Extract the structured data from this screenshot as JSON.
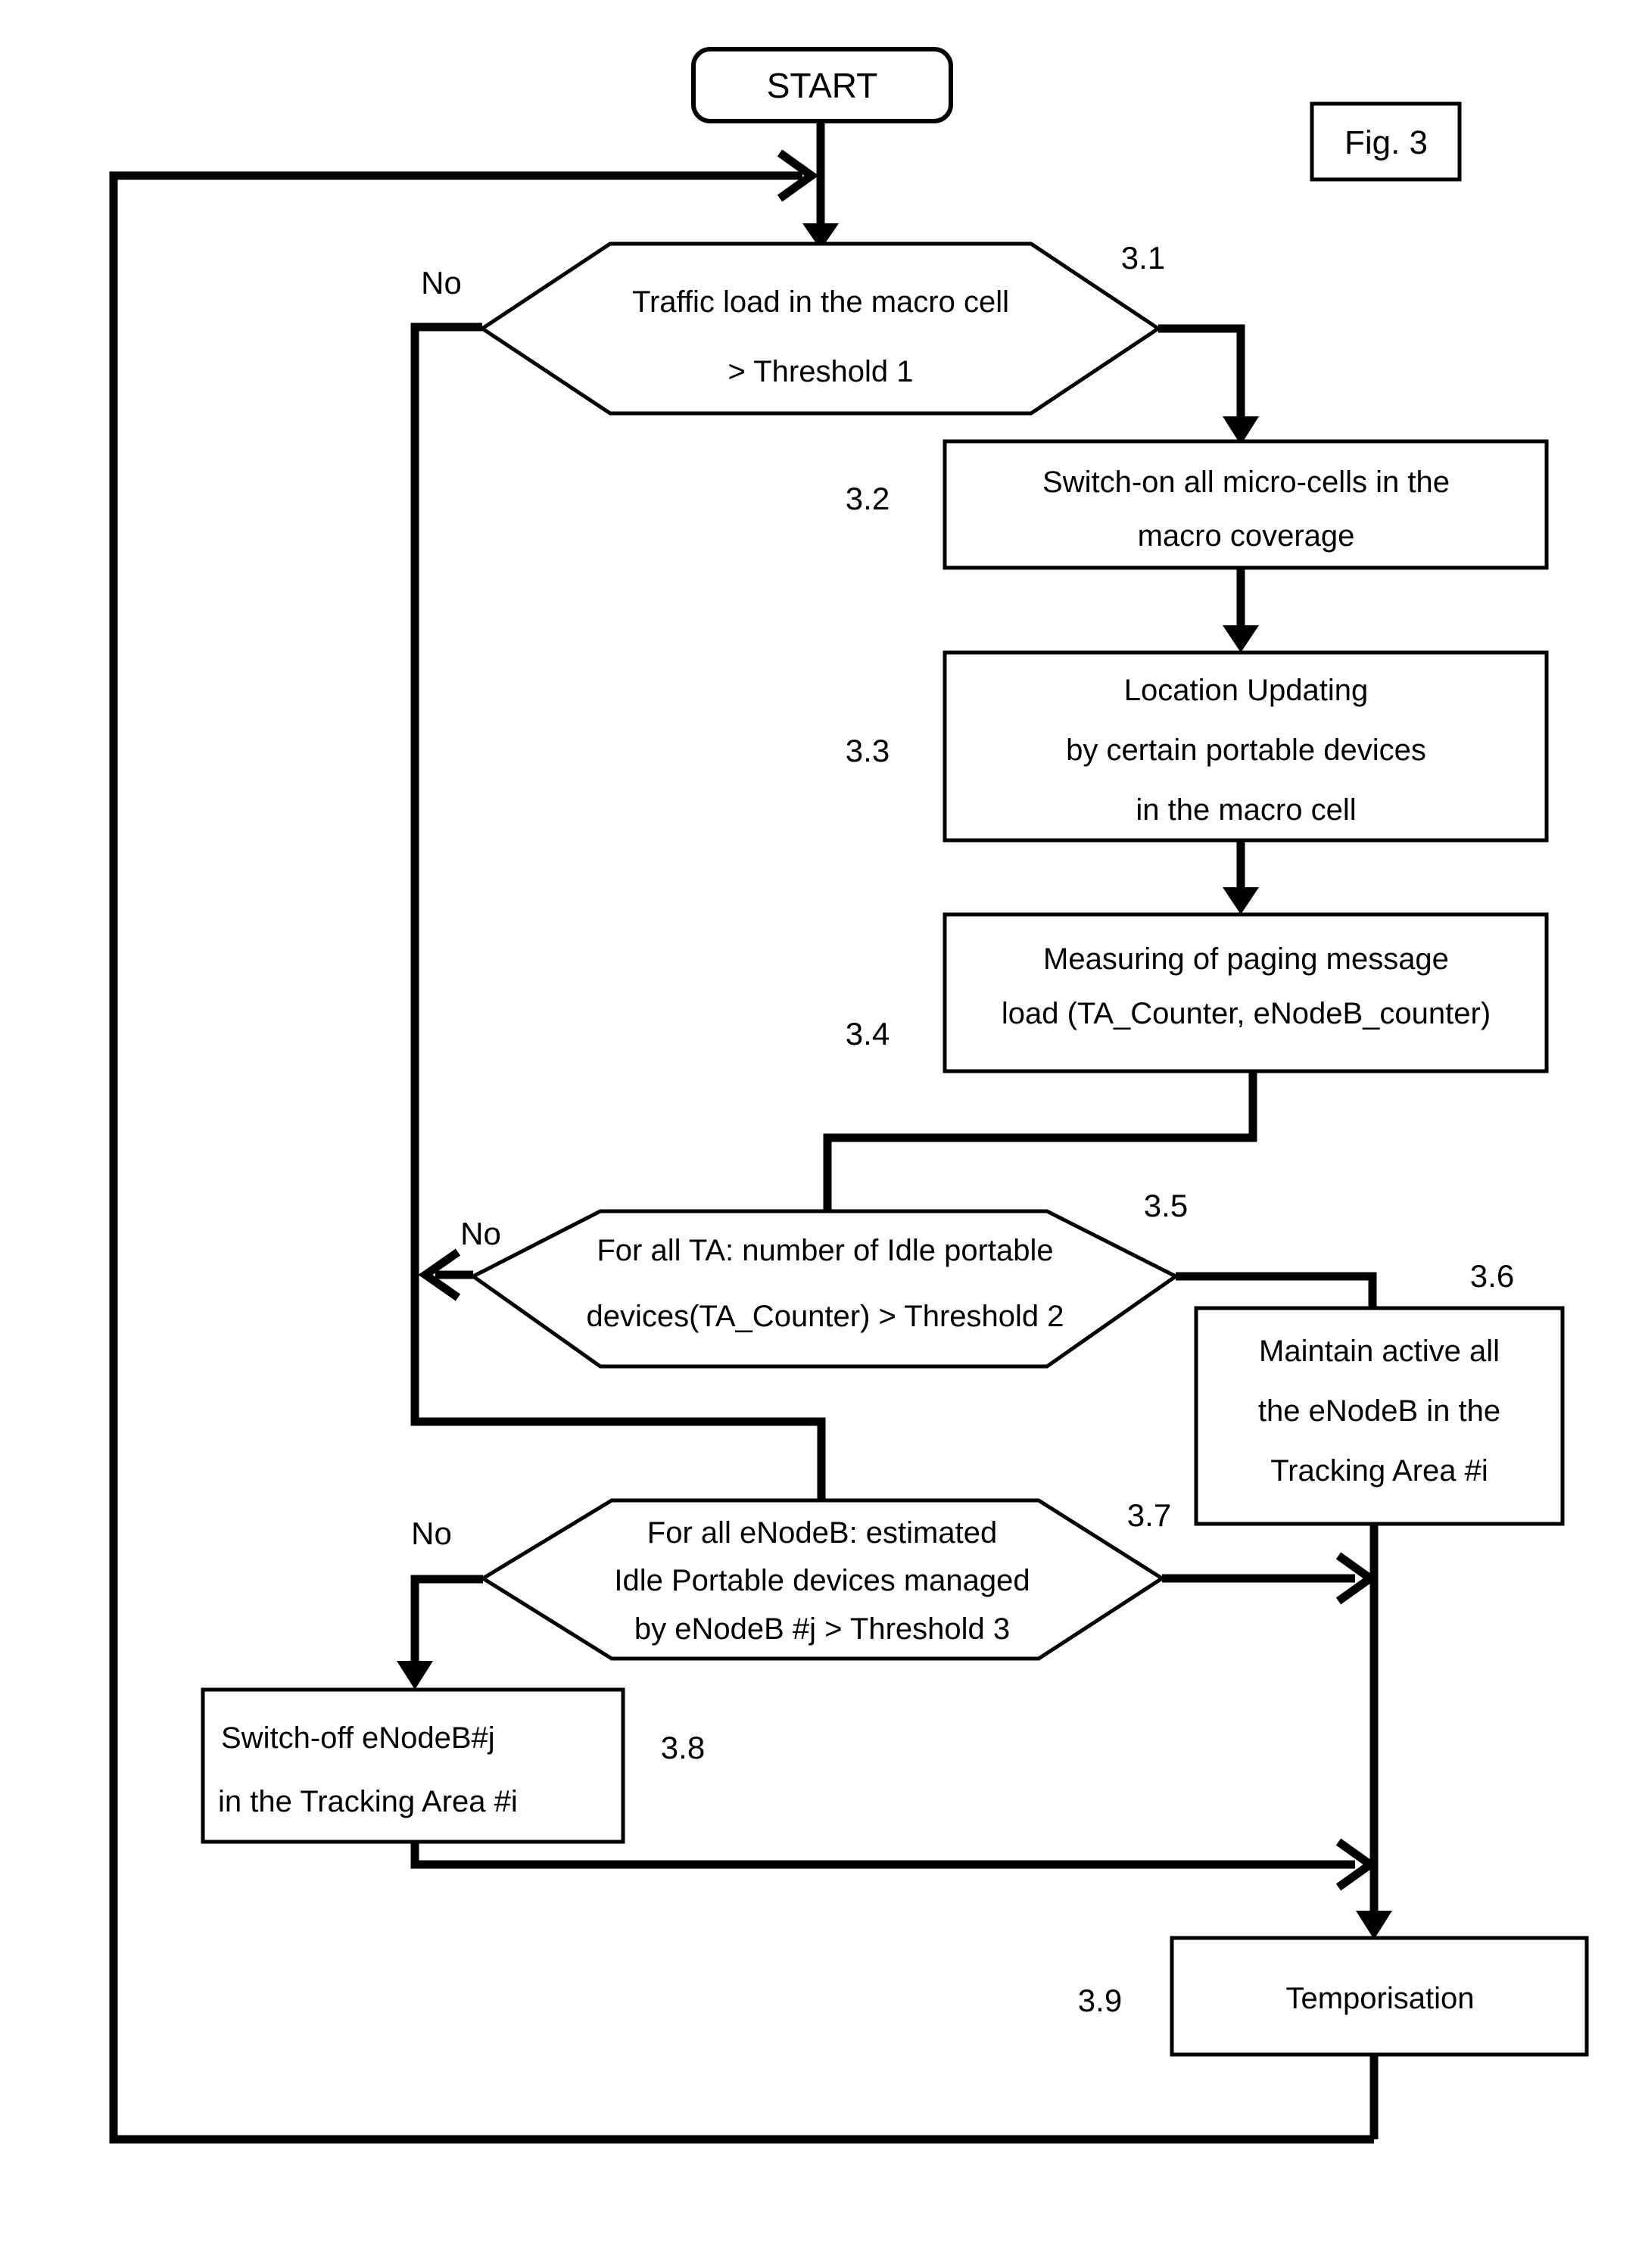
{
  "figure": {
    "label": "Fig. 3"
  },
  "nodes": {
    "start": {
      "label": "START",
      "shape": "rounded-rectangle"
    },
    "d31": {
      "step": "3.1",
      "shape": "hexagon",
      "lines": [
        "Traffic load in the macro cell",
        "> Threshold 1"
      ],
      "no_label": "No"
    },
    "p32": {
      "step": "3.2",
      "shape": "rectangle",
      "lines": [
        "Switch-on all micro-cells in the",
        "macro coverage"
      ]
    },
    "p33": {
      "step": "3.3",
      "shape": "rectangle",
      "lines": [
        "Location Updating",
        "by certain portable devices",
        "in the macro cell"
      ]
    },
    "p34": {
      "step": "3.4",
      "shape": "rectangle",
      "lines": [
        "Measuring of paging message",
        "load (TA_Counter, eNodeB_counter)"
      ]
    },
    "d35": {
      "step": "3.5",
      "shape": "hexagon",
      "lines": [
        "For all TA: number of Idle portable",
        "devices(TA_Counter) > Threshold 2"
      ],
      "no_label": "No"
    },
    "p36": {
      "step": "3.6",
      "shape": "rectangle",
      "lines": [
        "Maintain active all",
        "the eNodeB in the",
        "Tracking Area #i"
      ]
    },
    "d37": {
      "step": "3.7",
      "shape": "hexagon",
      "lines": [
        "For all eNodeB: estimated",
        "Idle Portable devices managed",
        "by eNodeB #j > Threshold 3"
      ],
      "no_label": "No"
    },
    "p38": {
      "step": "3.8",
      "shape": "rectangle",
      "lines": [
        "Switch-off eNodeB#j",
        "in the Tracking Area #i"
      ]
    },
    "p39": {
      "step": "3.9",
      "shape": "rectangle",
      "lines": [
        "Temporisation"
      ]
    }
  },
  "colors": {
    "stroke": "#000000",
    "fill": "#ffffff",
    "background": "#ffffff"
  }
}
